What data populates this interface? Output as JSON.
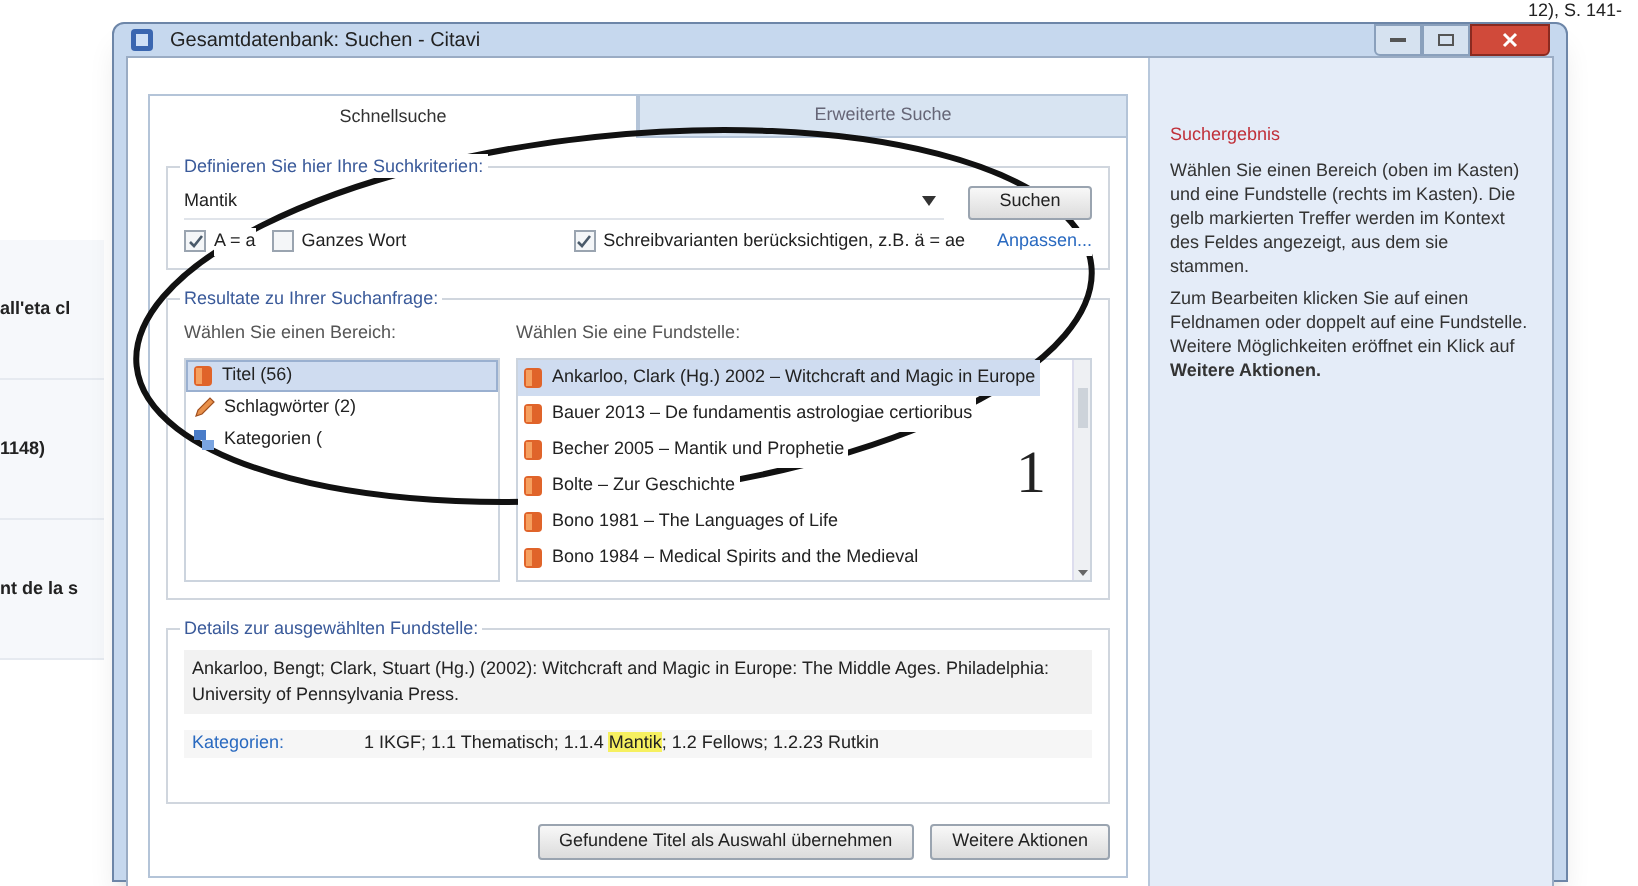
{
  "background": {
    "top_line": "12), S. 141-",
    "rows": [
      "all'eta cl",
      "1148)",
      "nt de la s"
    ]
  },
  "window": {
    "title": "Gesamtdatenbank: Suchen - Citavi"
  },
  "tabs": [
    {
      "label": "Schnellsuche",
      "selected": true
    },
    {
      "label": "Erweiterte Suche",
      "selected": false
    }
  ],
  "criteria": {
    "legend": "Definieren Sie hier Ihre Suchkriterien:",
    "query": "Mantik",
    "search_button": "Suchen",
    "options": [
      {
        "label": "A = a",
        "checked": true
      },
      {
        "label": "Ganzes Wort",
        "checked": false
      },
      {
        "label": "Schreibvarianten berücksichtigen, z.B. ä = ae",
        "checked": true
      }
    ],
    "customize_link": "Anpassen..."
  },
  "results": {
    "legend": "Resultate zu Ihrer Suchanfrage:",
    "areas_label": "Wählen Sie einen Bereich:",
    "areas": [
      {
        "label": "Titel (56)",
        "kind": "book",
        "selected": true
      },
      {
        "label": "Schlagwörter (2)",
        "kind": "keyword",
        "selected": false
      },
      {
        "label": "Kategorien (",
        "kind": "category",
        "selected": false
      }
    ],
    "hits_label": "Wählen Sie eine Fundstelle:",
    "hits": [
      {
        "label": "Ankarloo, Clark (Hg.) 2002 – Witchcraft and Magic in Europe",
        "selected": true
      },
      {
        "label": "Bauer 2013 – De fundamentis astrologiae certioribus",
        "selected": false
      },
      {
        "label": "Becher 2005 – Mantik und Prophetie",
        "selected": false
      },
      {
        "label": "Bolte – Zur Geschichte",
        "selected": false
      },
      {
        "label": "Bono 1981 – The Languages of Life",
        "selected": false
      },
      {
        "label": "Bono 1984 – Medical Spirits and the Medieval",
        "selected": false
      }
    ]
  },
  "details": {
    "legend": "Details zur ausgewählten Fundstelle:",
    "citation": "Ankarloo, Bengt; Clark, Stuart (Hg.) (2002): Witchcraft and Magic in Europe: The Middle Ages. Philadelphia: University of Pennsylvania Press.",
    "categories_label": "Kategorien:",
    "categories": [
      {
        "text": "1 IKGF; 1.1 Thematisch; 1.1.4 ",
        "highlighted": false
      },
      {
        "text": "Mantik",
        "highlighted": true
      },
      {
        "text": "; 1.2 Fellows; 1.2.23 Rutkin",
        "highlighted": false
      }
    ]
  },
  "buttons": [
    "Gefundene Titel als Auswahl übernehmen",
    "Weitere Aktionen"
  ],
  "help": {
    "title": "Suchergebnis",
    "paragraphs": [
      "Wählen Sie einen Bereich (oben im Kasten) und eine Fundstelle (rechts im Kasten). Die gelb markierten Treffer werden im Kontext des Feldes angezeigt, aus dem sie stammen.",
      "Zum Bearbeiten klicken Sie auf einen Feldnamen oder doppelt auf eine Fundstelle. Weitere Möglichkeiten eröffnet ein Klick auf **Weitere Aktionen.**"
    ]
  },
  "annotation": {
    "number": "1"
  }
}
